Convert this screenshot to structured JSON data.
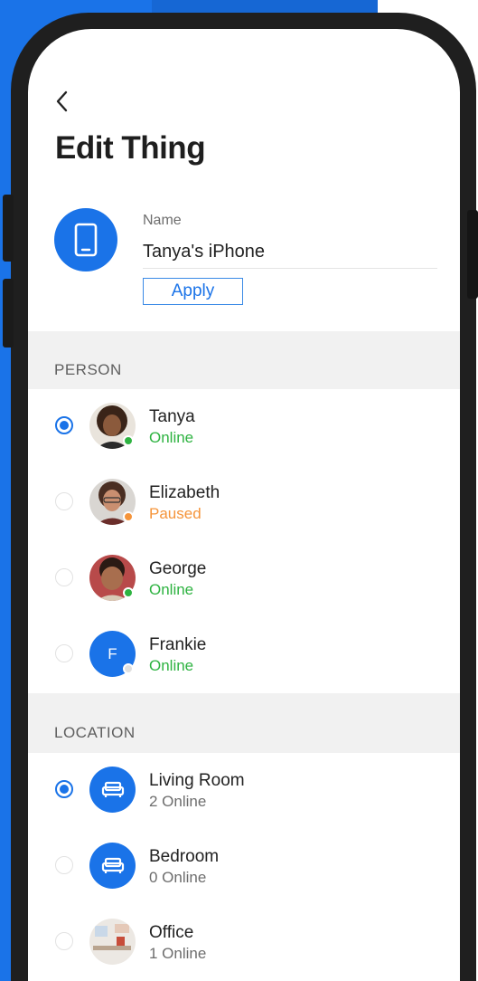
{
  "header": {
    "back_icon": "chevron-left-icon",
    "title": "Edit Thing"
  },
  "thing": {
    "icon": "smartphone-icon",
    "name_label": "Name",
    "name_value": "Tanya's iPhone",
    "apply_label": "Apply"
  },
  "person": {
    "header": "PERSON",
    "items": [
      {
        "name": "Tanya",
        "status": "Online",
        "selected": true
      },
      {
        "name": "Elizabeth",
        "status": "Paused",
        "selected": false
      },
      {
        "name": "George",
        "status": "Online",
        "selected": false
      },
      {
        "name": "Frankie",
        "status": "Online",
        "initial": "F",
        "selected": false
      }
    ]
  },
  "location": {
    "header": "LOCATION",
    "items": [
      {
        "name": "Living Room",
        "status": "2 Online",
        "icon": "sofa-icon",
        "selected": true
      },
      {
        "name": "Bedroom",
        "status": "0 Online",
        "icon": "bed-icon",
        "selected": false
      },
      {
        "name": "Office",
        "status": "1 Online",
        "selected": false
      }
    ]
  },
  "colors": {
    "accent": "#1a73e8",
    "online": "#2eb341",
    "paused": "#f5943a",
    "frame": "#1f1f1f",
    "section_bg": "#f1f1f1"
  }
}
